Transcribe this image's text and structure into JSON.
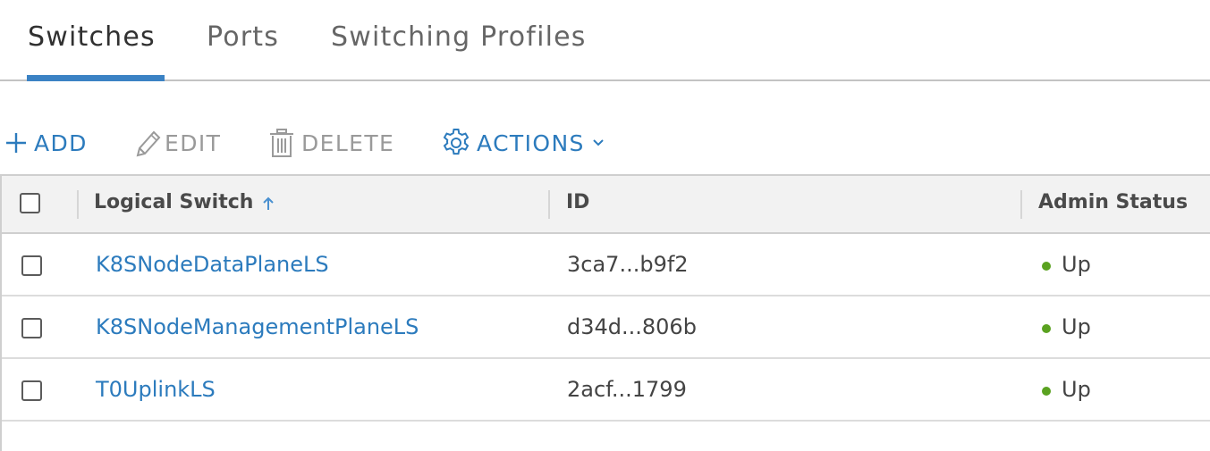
{
  "tabs": [
    {
      "label": "Switches",
      "active": true
    },
    {
      "label": "Ports",
      "active": false
    },
    {
      "label": "Switching Profiles",
      "active": false
    }
  ],
  "toolbar": {
    "add_label": "ADD",
    "edit_label": "EDIT",
    "delete_label": "DELETE",
    "actions_label": "ACTIONS",
    "icons": {
      "add": "plus-icon",
      "edit": "pencil-icon",
      "delete": "trash-icon",
      "actions": "gear-icon",
      "actions_dropdown": "chevron-down-icon"
    }
  },
  "table": {
    "columns": [
      "Logical Switch",
      "ID",
      "Admin Status"
    ],
    "sort": {
      "column": "Logical Switch",
      "direction": "ascending"
    },
    "rows": [
      {
        "name": "K8SNodeDataPlaneLS",
        "id": "3ca7...b9f2",
        "status": "Up"
      },
      {
        "name": "K8SNodeManagementPlaneLS",
        "id": "d34d...806b",
        "status": "Up"
      },
      {
        "name": "T0UplinkLS",
        "id": "2acf...1799",
        "status": "Up"
      }
    ]
  },
  "colors": {
    "accent": "#3b82c4",
    "link": "#2c7bbd",
    "status_up": "#5aa220",
    "disabled": "#9a9a9a"
  }
}
